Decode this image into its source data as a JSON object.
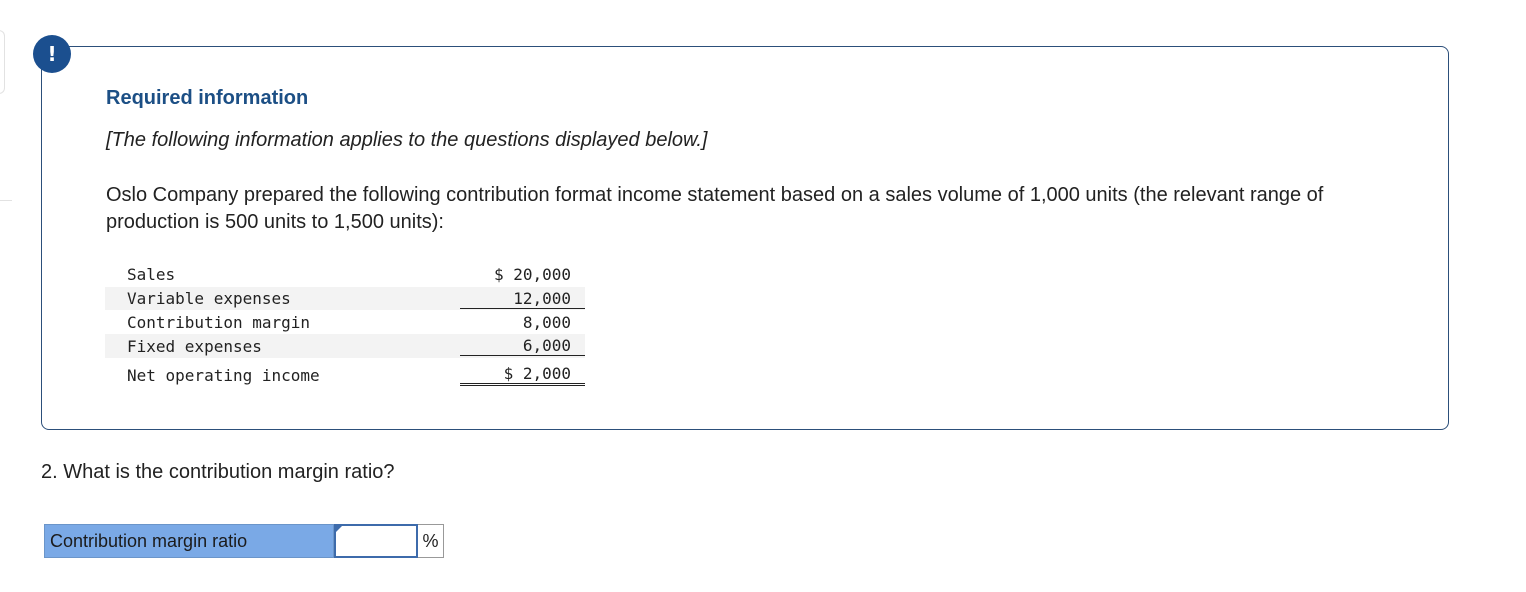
{
  "alert": {
    "icon": "exclamation-icon",
    "symbol": "!"
  },
  "info": {
    "title": "Required information",
    "note": "[The following information applies to the questions displayed below.]",
    "text": "Oslo Company prepared the following contribution format income statement based on a sales volume of 1,000 units (the relevant range of production is 500 units to 1,500 units):"
  },
  "statement": {
    "rows": [
      {
        "label": "Sales",
        "amount": "$ 20,000"
      },
      {
        "label": "Variable expenses",
        "amount": "12,000"
      },
      {
        "label": "Contribution margin",
        "amount": "8,000"
      },
      {
        "label": "Fixed expenses",
        "amount": "6,000"
      },
      {
        "label": "Net operating income",
        "amount": "$ 2,000"
      }
    ]
  },
  "question": {
    "text": "2. What is the contribution margin ratio?"
  },
  "answer": {
    "label": "Contribution margin ratio",
    "value": "",
    "unit": "%"
  },
  "colors": {
    "accent": "#1b4f8f",
    "label_fill": "#7aa9e6",
    "box_border": "#2c4f7a"
  }
}
